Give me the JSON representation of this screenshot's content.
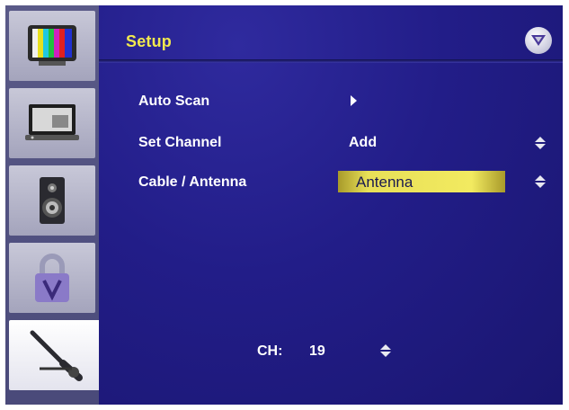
{
  "header": {
    "title": "Setup"
  },
  "sidebar": {
    "items": [
      {
        "name": "picture",
        "icon": "color-bars-tv-icon",
        "active": false
      },
      {
        "name": "display",
        "icon": "monitor-icon",
        "active": false
      },
      {
        "name": "audio",
        "icon": "speaker-icon",
        "active": false
      },
      {
        "name": "lock",
        "icon": "padlock-icon",
        "active": false
      },
      {
        "name": "setup",
        "icon": "wrench-icon",
        "active": true
      }
    ]
  },
  "menu": {
    "rows": [
      {
        "label": "Auto Scan",
        "value": "",
        "control": "arrow-right-icon"
      },
      {
        "label": "Set Channel",
        "value": "Add",
        "control": "up-down-arrows-icon"
      },
      {
        "label": "Cable / Antenna",
        "value": "Antenna",
        "control": "up-down-arrows-icon",
        "selected": true
      }
    ]
  },
  "channel": {
    "label": "CH:",
    "value": "19"
  },
  "colors": {
    "accent": "#f1e94e",
    "panel": "#221d88",
    "highlight": "#f2ea60",
    "text": "#ffffff"
  }
}
